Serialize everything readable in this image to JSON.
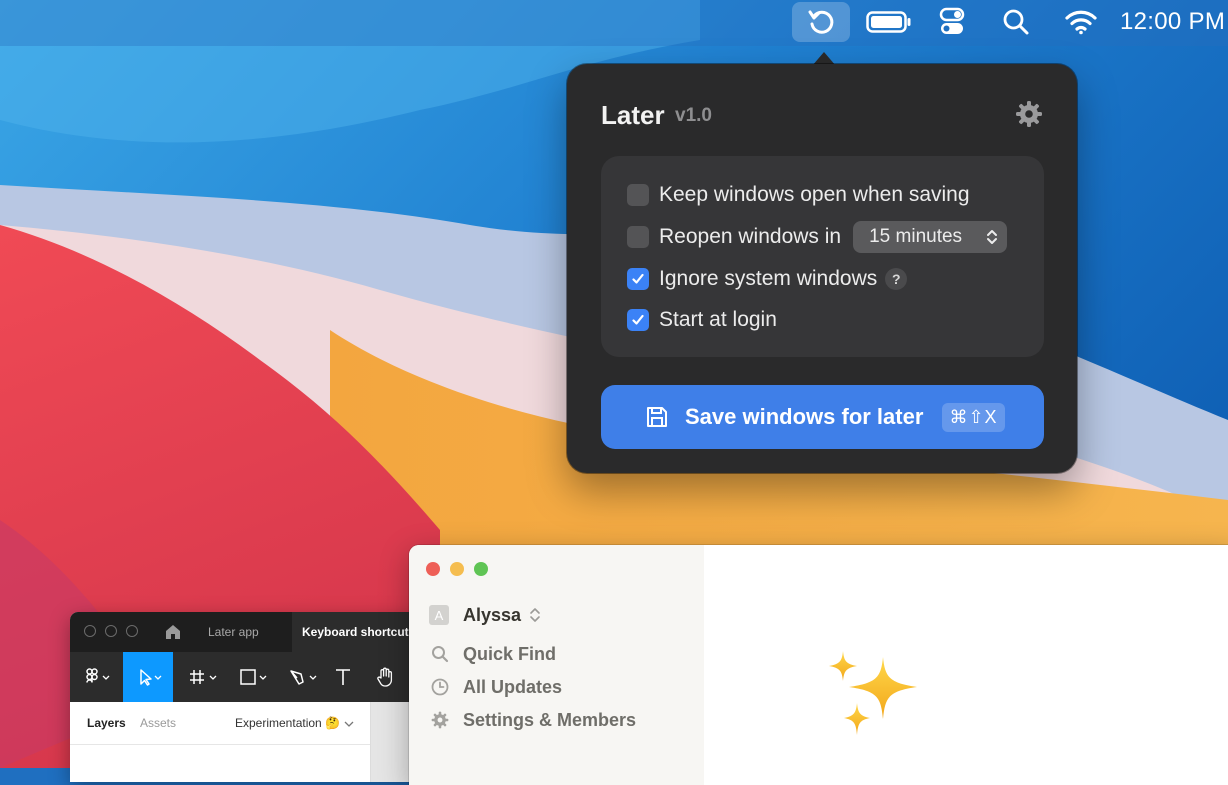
{
  "menubar": {
    "clock": "12:00 PM",
    "icons": [
      "later-refresh-icon",
      "battery-icon",
      "control-center-icon",
      "search-icon",
      "wifi-icon"
    ]
  },
  "popover": {
    "title": "Later",
    "version": "v1.0",
    "options": [
      {
        "label": "Keep windows open when saving",
        "checked": false
      },
      {
        "label": "Reopen windows in",
        "checked": false,
        "select_value": "15 minutes"
      },
      {
        "label": "Ignore system windows",
        "checked": true,
        "help": "?"
      },
      {
        "label": "Start at login",
        "checked": true
      }
    ],
    "save_button": {
      "label": "Save windows for later",
      "shortcut": "⌘⇧X"
    },
    "colors": {
      "background": "#2a2a2b",
      "accent": "#3f7fe8"
    }
  },
  "figma": {
    "tabs": [
      "Later app",
      "Keyboard shortcuts"
    ],
    "panel_tabs": [
      "Layers",
      "Assets"
    ],
    "page": "Experimentation 🤔"
  },
  "notion": {
    "workspace": {
      "avatar": "A",
      "name": "Alyssa"
    },
    "sidebar_items": [
      "Quick Find",
      "All Updates",
      "Settings & Members"
    ],
    "content_icon": "sparkles-icon"
  }
}
